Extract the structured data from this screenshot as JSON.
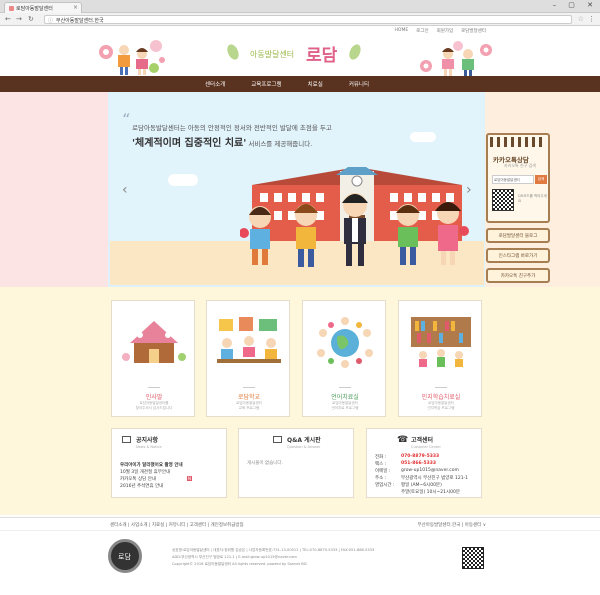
{
  "browser": {
    "tab_title": "로담아동발달센터",
    "url": "부산아동발달센터.한국",
    "win_controls": "–  ▢  ✕"
  },
  "header": {
    "toplinks": [
      "HOME",
      "로그인",
      "회원가입",
      "로담발달센터"
    ],
    "logo_small": "아동발달센터",
    "logo_big": "로담"
  },
  "nav": {
    "items": [
      "센터소개",
      "교육프로그램",
      "치료실",
      "커뮤니티"
    ]
  },
  "hero": {
    "line1": "로담아동발달센터는 아동의 안정적인 정서와 전반적인 발달에 초점을 두고",
    "line2_bold": "'체계적이며 집중적인 치료'",
    "line2_rest": " 서비스를 제공해줍니다."
  },
  "consult": {
    "title": "카카오톡상담",
    "sub": "카카오톡 친구 검색",
    "input": "로담아동발달센터",
    "button": "검색",
    "qr_text": "QR코드를 찍어주세요"
  },
  "side_buttons": [
    "로담발달센터 블로그",
    "인스타그램 바로가기",
    "카카오톡 친구추가"
  ],
  "programs": [
    {
      "name": "인사말",
      "desc": "로담아동발달센터를\n찾아주셔서 감사드립니다",
      "color": "#e05a6a"
    },
    {
      "name": "로담학교",
      "desc": "로담아동발달센터\n교육 프로그램",
      "color": "#e07a3a"
    },
    {
      "name": "언어치료실",
      "desc": "로담아동발달센터\n언어치료 프로그램",
      "color": "#4a9a5a"
    },
    {
      "name": "인지학습치료실",
      "desc": "로담아동발달센터\n인지학습 프로그램",
      "color": "#e05a6a"
    }
  ],
  "notice": {
    "title": "공지사항",
    "sub": "News & Notice",
    "items": [
      "우리아이가 달라졌어요 촬영 안내",
      "10월 3일 개천절 휴무안내",
      "카카오톡 상담 안내",
      "2016년 추석연휴 안내"
    ]
  },
  "qna": {
    "title": "Q&A 게시판",
    "sub": "Question & Answer",
    "empty": "게시물이 없습니다."
  },
  "customer": {
    "title": "고객센터",
    "sub": "Customer Center",
    "rows": [
      {
        "k": "전화 :",
        "v": "070-8879-5333",
        "red": true
      },
      {
        "k": "팩스 :",
        "v": "051-866-5333",
        "red": true
      },
      {
        "k": "이메일 :",
        "v": "grow-up1015@naver.com",
        "red": false
      },
      {
        "k": "주소 :",
        "v": "부산광역시 부산진구 범양로 121-1",
        "red": false
      },
      {
        "k": "영업시간 :",
        "v": "평일 (AM~6시00분)",
        "red": false
      },
      {
        "k": "",
        "v": "주말(토요일) 10시~21시00분",
        "red": false
      }
    ]
  },
  "footer": {
    "links": "센터소개 | 사업소개 | 치료실 | 커뮤니티 | 고객센터 | 개인정보취급방침",
    "right": "부산아동발달센터.한국 | 아동센터 ∨",
    "seal": "로담",
    "info": [
      "상호명:로담아동발달센터 | 대표자:장위원 김승은 | 사업자등록번호:751-13-00512 | TEL:070-8879-5333 | FAX:051-866-5333",
      "ADD:부산광역시 부산진구 범양로 121-1 | E-mail:grow-up1015@naver.com",
      "Copyright© 2016 로담아동발달센터 All rights reserved. powerd by Sannet INC"
    ]
  }
}
